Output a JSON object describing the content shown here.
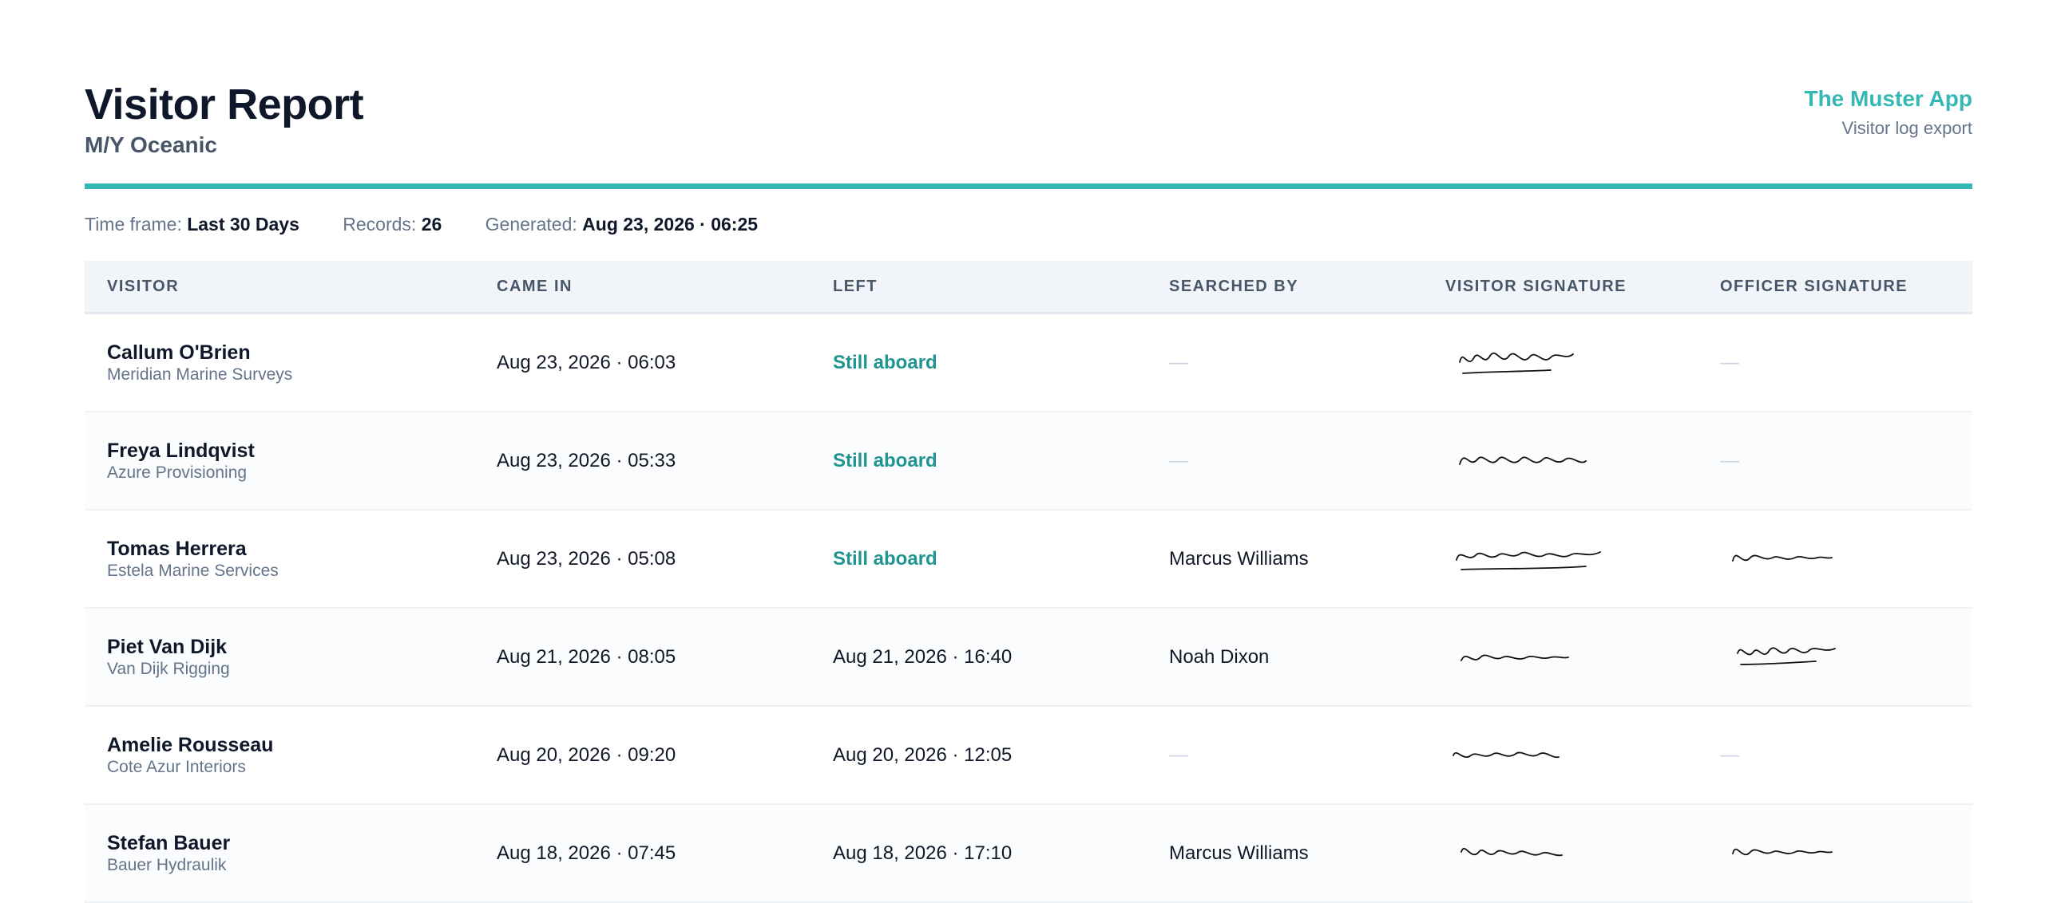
{
  "header": {
    "title": "Visitor Report",
    "vessel": "M/Y Oceanic",
    "brand": "The Muster App",
    "brand_sub": "Visitor log export"
  },
  "meta": {
    "timeframe_label": "Time frame:",
    "timeframe_value": "Last 30 Days",
    "records_label": "Records:",
    "records_value": "26",
    "generated_label": "Generated:",
    "generated_value": "Aug 23, 2026 · 06:25"
  },
  "table": {
    "headers": [
      "VISITOR",
      "CAME IN",
      "LEFT",
      "SEARCHED BY",
      "VISITOR SIGNATURE",
      "OFFICER SIGNATURE"
    ],
    "rows": [
      {
        "name": "Callum O'Brien",
        "company": "Meridian Marine Surveys",
        "came_in": "Aug 23, 2026 · 06:03",
        "left": "Still aboard",
        "left_status": "aboard",
        "searched_by": "—",
        "visitor_signature": "present",
        "officer_signature": "—"
      },
      {
        "name": "Freya Lindqvist",
        "company": "Azure Provisioning",
        "came_in": "Aug 23, 2026 · 05:33",
        "left": "Still aboard",
        "left_status": "aboard",
        "searched_by": "—",
        "visitor_signature": "present",
        "officer_signature": "—"
      },
      {
        "name": "Tomas Herrera",
        "company": "Estela Marine Services",
        "came_in": "Aug 23, 2026 · 05:08",
        "left": "Still aboard",
        "left_status": "aboard",
        "searched_by": "Marcus Williams",
        "visitor_signature": "present",
        "officer_signature": "present"
      },
      {
        "name": "Piet Van Dijk",
        "company": "Van Dijk Rigging",
        "came_in": "Aug 21, 2026 · 08:05",
        "left": "Aug 21, 2026 · 16:40",
        "left_status": "departed",
        "searched_by": "Noah Dixon",
        "visitor_signature": "present",
        "officer_signature": "present"
      },
      {
        "name": "Amelie Rousseau",
        "company": "Cote Azur Interiors",
        "came_in": "Aug 20, 2026 · 09:20",
        "left": "Aug 20, 2026 · 12:05",
        "left_status": "departed",
        "searched_by": "—",
        "visitor_signature": "present",
        "officer_signature": "—"
      },
      {
        "name": "Stefan Bauer",
        "company": "Bauer Hydraulik",
        "came_in": "Aug 18, 2026 · 07:45",
        "left": "Aug 18, 2026 · 17:10",
        "left_status": "departed",
        "searched_by": "Marcus Williams",
        "visitor_signature": "present",
        "officer_signature": "present"
      }
    ]
  },
  "colors": {
    "accent": "#35b8b4",
    "aboard": "#1f9490",
    "heading": "#0f172a",
    "muted": "#64748b"
  }
}
